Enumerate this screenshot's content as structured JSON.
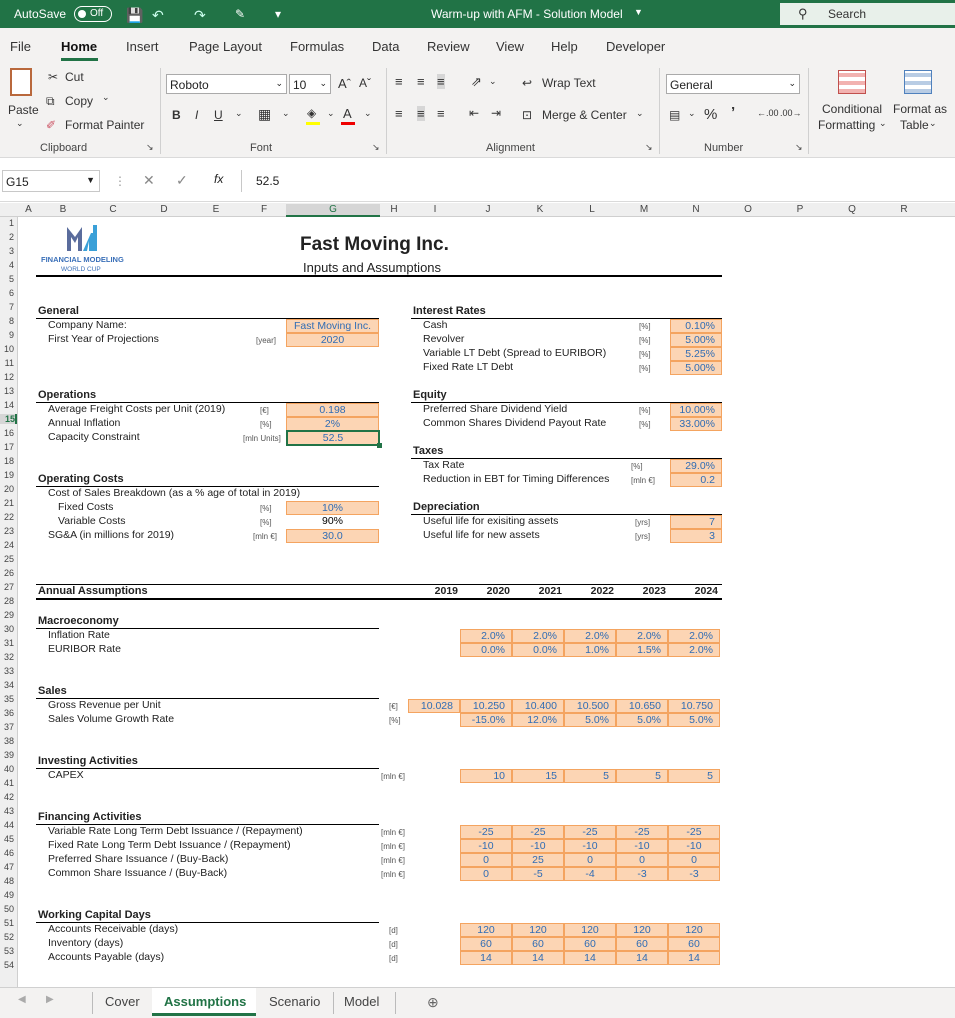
{
  "titlebar": {
    "autosave": "AutoSave",
    "autosave_state": "Off",
    "title": "Warm-up with AFM - Solution Model",
    "search": "Search"
  },
  "menu": [
    "File",
    "Home",
    "Insert",
    "Page Layout",
    "Formulas",
    "Data",
    "Review",
    "View",
    "Help",
    "Developer"
  ],
  "ribbon": {
    "paste": "Paste",
    "cut": "Cut",
    "copy": "Copy",
    "format_painter": "Format Painter",
    "clipboard": "Clipboard",
    "font_name": "Roboto",
    "font_size": "10",
    "font": "Font",
    "wrap_text": "Wrap Text",
    "merge_center": "Merge & Center",
    "alignment": "Alignment",
    "number_format": "General",
    "number": "Number",
    "conditional_formatting": "Conditional",
    "conditional_formatting2": "Formatting",
    "format_as_table": "Format as",
    "format_as_table2": "Table"
  },
  "formula_bar": {
    "name_box": "G15",
    "formula": "52.5"
  },
  "columns": [
    "A",
    "B",
    "C",
    "D",
    "E",
    "F",
    "G",
    "H",
    "I",
    "J",
    "K",
    "L",
    "M",
    "N",
    "O",
    "P",
    "Q",
    "R"
  ],
  "rows": [
    "1",
    "2",
    "3",
    "4",
    "5",
    "6",
    "7",
    "8",
    "9",
    "10",
    "11",
    "12",
    "13",
    "14",
    "15",
    "16",
    "17",
    "18",
    "19",
    "20",
    "21",
    "22",
    "23",
    "24",
    "25",
    "26",
    "27",
    "28",
    "29",
    "30",
    "31",
    "32",
    "33",
    "34",
    "35",
    "36",
    "37",
    "38",
    "39",
    "40",
    "41",
    "42",
    "43",
    "44",
    "45",
    "46",
    "47",
    "48",
    "49",
    "50",
    "51",
    "52",
    "53",
    "54"
  ],
  "sheet": {
    "logo_line1": "FINANCIAL MODELING",
    "logo_line2": "WORLD CUP",
    "title": "Fast Moving Inc.",
    "subtitle": "Inputs and Assumptions",
    "general": {
      "header": "General",
      "company_label": "Company Name:",
      "company_value": "Fast Moving Inc.",
      "first_year_label": "First Year of Projections",
      "first_year_unit": "[year]",
      "first_year_value": "2020"
    },
    "operations": {
      "header": "Operations",
      "freight_label": "Average Freight Costs per Unit (2019)",
      "freight_unit": "[€]",
      "freight_value": "0.198",
      "inflation_label": "Annual Inflation",
      "inflation_unit": "[%]",
      "inflation_value": "2%",
      "capacity_label": "Capacity Constraint",
      "capacity_unit": "[mln Units]",
      "capacity_value": "52.5"
    },
    "opcosts": {
      "header": "Operating Costs",
      "breakdown_label": "Cost of Sales Breakdown (as a % age of total in 2019)",
      "fixed_label": "Fixed Costs",
      "fixed_unit": "[%]",
      "fixed_value": "10%",
      "variable_label": "Variable Costs",
      "variable_unit": "[%]",
      "variable_value": "90%",
      "sga_label": "SG&A (in millions for 2019)",
      "sga_unit": "[mln €]",
      "sga_value": "30.0"
    },
    "interest": {
      "header": "Interest Rates",
      "items": [
        {
          "label": "Cash",
          "unit": "[%]",
          "value": "0.10%"
        },
        {
          "label": "Revolver",
          "unit": "[%]",
          "value": "5.00%"
        },
        {
          "label": "Variable LT Debt (Spread to EURIBOR)",
          "unit": "[%]",
          "value": "5.25%"
        },
        {
          "label": "Fixed Rate LT Debt",
          "unit": "[%]",
          "value": "5.00%"
        }
      ]
    },
    "equity": {
      "header": "Equity",
      "items": [
        {
          "label": "Preferred Share Dividend Yield",
          "unit": "[%]",
          "value": "10.00%"
        },
        {
          "label": "Common Shares Dividend Payout Rate",
          "unit": "[%]",
          "value": "33.00%"
        }
      ]
    },
    "taxes": {
      "header": "Taxes",
      "items": [
        {
          "label": "Tax Rate",
          "unit": "[%]",
          "value": "29.0%"
        },
        {
          "label": "Reduction in EBT for Timing Differences",
          "unit": "[mln €]",
          "value": "0.2"
        }
      ]
    },
    "depreciation": {
      "header": "Depreciation",
      "items": [
        {
          "label": "Useful life for exisiting assets",
          "unit": "[yrs]",
          "value": "7"
        },
        {
          "label": "Useful life for new assets",
          "unit": "[yrs]",
          "value": "3"
        }
      ]
    },
    "annual": {
      "header": "Annual Assumptions",
      "years": [
        "2019",
        "2020",
        "2021",
        "2022",
        "2023",
        "2024"
      ]
    },
    "macro": {
      "header": "Macroeconomy",
      "inflation_label": "Inflation Rate",
      "inflation": [
        "2.0%",
        "2.0%",
        "2.0%",
        "2.0%",
        "2.0%"
      ],
      "euribor_label": "EURIBOR Rate",
      "euribor": [
        "0.0%",
        "0.0%",
        "1.0%",
        "1.5%",
        "2.0%"
      ]
    },
    "sales": {
      "header": "Sales",
      "revenue_label": "Gross Revenue per Unit",
      "revenue_unit": "[€]",
      "revenue_2019": "10.028",
      "revenue": [
        "10.250",
        "10.400",
        "10.500",
        "10.650",
        "10.750"
      ],
      "growth_label": "Sales Volume Growth Rate",
      "growth_unit": "[%]",
      "growth": [
        "-15.0%",
        "12.0%",
        "5.0%",
        "5.0%",
        "5.0%"
      ]
    },
    "investing": {
      "header": "Investing Activities",
      "capex_label": "CAPEX",
      "capex_unit": "[mln €]",
      "capex": [
        "10",
        "15",
        "5",
        "5",
        "5"
      ]
    },
    "financing": {
      "header": "Financing Activities",
      "rows": [
        {
          "label": "Variable Rate Long Term Debt Issuance / (Repayment)",
          "unit": "[mln €]",
          "values": [
            "-25",
            "-25",
            "-25",
            "-25",
            "-25"
          ]
        },
        {
          "label": "Fixed Rate Long Term Debt Issuance / (Repayment)",
          "unit": "[mln €]",
          "values": [
            "-10",
            "-10",
            "-10",
            "-10",
            "-10"
          ]
        },
        {
          "label": "Preferred Share Issuance / (Buy-Back)",
          "unit": "[mln €]",
          "values": [
            "0",
            "25",
            "0",
            "0",
            "0"
          ]
        },
        {
          "label": "Common Share Issuance / (Buy-Back)",
          "unit": "[mln €]",
          "values": [
            "0",
            "-5",
            "-4",
            "-3",
            "-3"
          ]
        }
      ]
    },
    "wc": {
      "header": "Working Capital Days",
      "rows": [
        {
          "label": "Accounts Receivable (days)",
          "unit": "[d]",
          "values": [
            "120",
            "120",
            "120",
            "120",
            "120"
          ]
        },
        {
          "label": "Inventory (days)",
          "unit": "[d]",
          "values": [
            "60",
            "60",
            "60",
            "60",
            "60"
          ]
        },
        {
          "label": "Accounts Payable (days)",
          "unit": "[d]",
          "values": [
            "14",
            "14",
            "14",
            "14",
            "14"
          ]
        }
      ]
    }
  },
  "tabs": [
    "Cover",
    "Assumptions",
    "Scenario",
    "Model"
  ],
  "active_tab": "Assumptions"
}
